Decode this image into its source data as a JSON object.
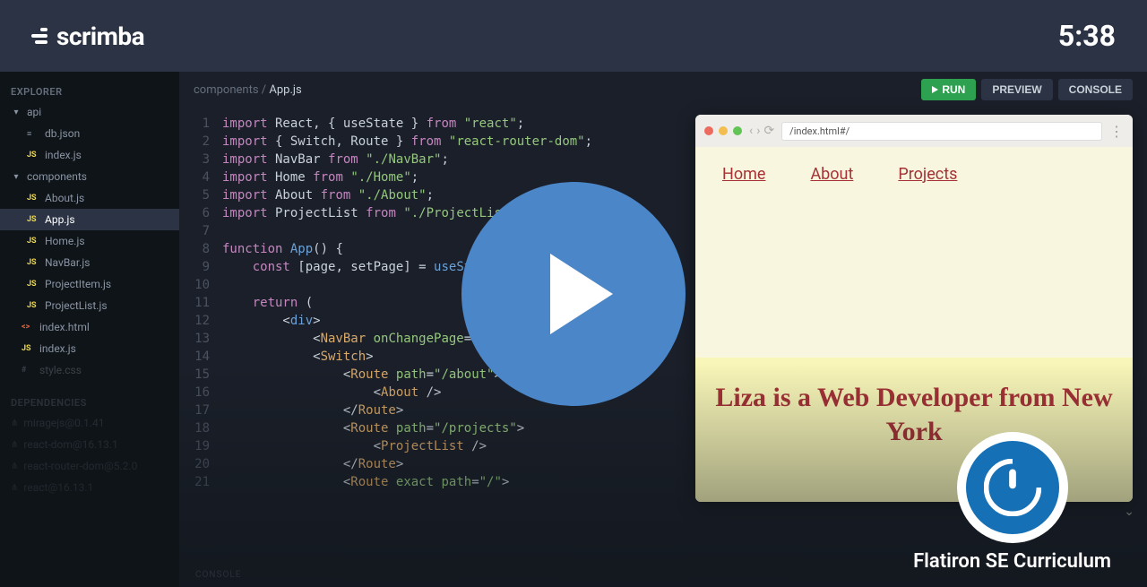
{
  "header": {
    "brand": "scrimba",
    "timer": "5:38"
  },
  "sidebar": {
    "explorer_label": "EXPLORER",
    "folders": {
      "api": "api",
      "components": "components"
    },
    "files": {
      "dbjson": "db.json",
      "api_index": "index.js",
      "about": "About.js",
      "app": "App.js",
      "home": "Home.js",
      "navbar": "NavBar.js",
      "projectitem": "ProjectItem.js",
      "projectlist": "ProjectList.js",
      "indexhtml": "index.html",
      "indexjs": "index.js",
      "stylecss": "style.css"
    },
    "deps_label": "DEPENDENCIES",
    "deps": [
      "miragejs@0.1.41",
      "react-dom@16.13.1",
      "react-router-dom@5.2.0",
      "react@16.13.1"
    ]
  },
  "toolbar": {
    "breadcrumb_parent": "components",
    "breadcrumb_sep": " / ",
    "breadcrumb_current": "App.js",
    "run": "RUN",
    "preview": "PREVIEW",
    "console": "CONSOLE"
  },
  "code": {
    "lines": [
      {
        "n": "1",
        "h": "<span class='kw'>import</span> React, { useState } <span class='kw'>from</span> <span class='str'>\"react\"</span>;"
      },
      {
        "n": "2",
        "h": "<span class='kw'>import</span> { Switch, Route } <span class='kw'>from</span> <span class='str'>\"react-router-dom\"</span>;"
      },
      {
        "n": "3",
        "h": "<span class='kw'>import</span> NavBar <span class='kw'>from</span> <span class='str'>\"./NavBar\"</span>;"
      },
      {
        "n": "4",
        "h": "<span class='kw'>import</span> Home <span class='kw'>from</span> <span class='str'>\"./Home\"</span>;"
      },
      {
        "n": "5",
        "h": "<span class='kw'>import</span> About <span class='kw'>from</span> <span class='str'>\"./About\"</span>;"
      },
      {
        "n": "6",
        "h": "<span class='kw'>import</span> ProjectList <span class='kw'>from</span> <span class='str'>\"./ProjectList\"</span>;"
      },
      {
        "n": "7",
        "h": ""
      },
      {
        "n": "8",
        "h": "<span class='kw'>function</span> <span class='fn'>App</span>() {"
      },
      {
        "n": "9",
        "h": "    <span class='kw'>const</span> [page, setPage] = <span class='fn'>useState</span>(<span class='str'>\"/\"</span>)"
      },
      {
        "n": "10",
        "h": ""
      },
      {
        "n": "11",
        "h": "    <span class='kw'>return</span> ("
      },
      {
        "n": "12",
        "h": "        &lt;<span class='tag'>div</span>&gt;"
      },
      {
        "n": "13",
        "h": "            &lt;<span class='cmp'>NavBar</span> <span class='attr'>onChangePage</span>={setPage} /&gt;"
      },
      {
        "n": "14",
        "h": "            &lt;<span class='cmp'>Switch</span>&gt;"
      },
      {
        "n": "15",
        "h": "                &lt;<span class='cmp'>Route</span> <span class='attr'>path</span>=<span class='str'>\"/about\"</span>&gt;"
      },
      {
        "n": "16",
        "h": "                    &lt;<span class='cmp'>About</span> /&gt;"
      },
      {
        "n": "17",
        "h": "                &lt;/<span class='cmp'>Route</span>&gt;"
      },
      {
        "n": "18",
        "h": "                &lt;<span class='cmp'>Route</span> <span class='attr'>path</span>=<span class='str'>\"/projects\"</span>&gt;"
      },
      {
        "n": "19",
        "h": "                    &lt;<span class='cmp'>ProjectList</span> /&gt;"
      },
      {
        "n": "20",
        "h": "                &lt;/<span class='cmp'>Route</span>&gt;"
      },
      {
        "n": "21",
        "h": "                &lt;<span class='cmp'>Route</span> <span class='attr'>exact path</span>=<span class='str'>\"/\"</span>&gt;"
      }
    ]
  },
  "console_label": "CONSOLE",
  "preview": {
    "address": "/index.html#/",
    "nav": {
      "home": "Home",
      "about": "About",
      "projects": "Projects"
    },
    "heading": "Liza is a Web Developer from New York"
  },
  "author": {
    "name": "Flatiron SE Curriculum"
  }
}
